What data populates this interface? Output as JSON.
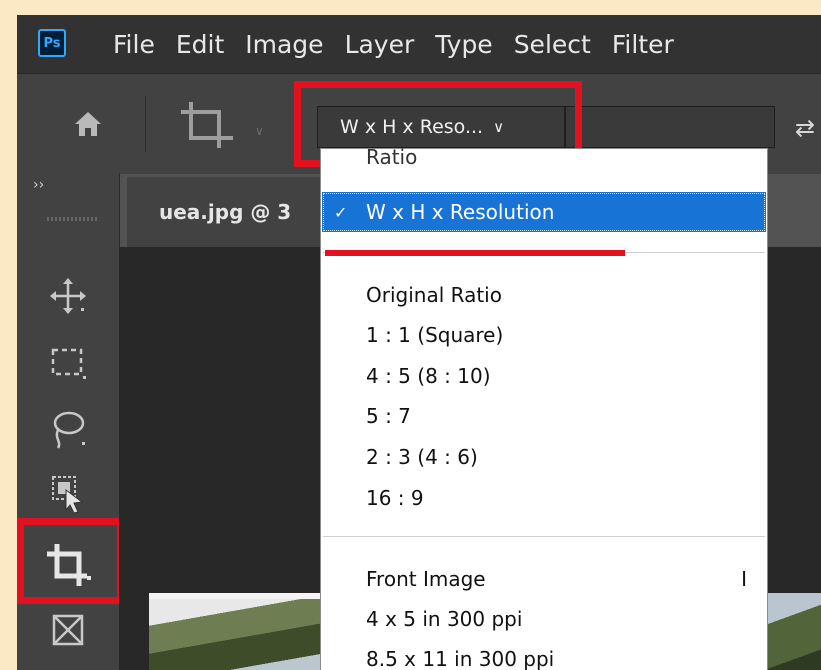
{
  "app": {
    "logo": "Ps"
  },
  "menubar": {
    "items": [
      "File",
      "Edit",
      "Image",
      "Layer",
      "Type",
      "Select",
      "Filter"
    ]
  },
  "options_bar": {
    "preset_value": "W x H x Reso...",
    "preset_chevron": "∨",
    "swap_icon": "⇄"
  },
  "toolbar": {
    "collapse_glyph": "››",
    "tools": [
      "move-tool",
      "marquee-tool",
      "lasso-tool",
      "object-selection-tool",
      "crop-tool",
      "frame-tool"
    ],
    "active_tool": "crop-tool"
  },
  "document": {
    "tab_label": "uea.jpg @ 3"
  },
  "dropdown": {
    "header": "Ratio",
    "selected": {
      "check": "✓",
      "label": "W x H x Resolution"
    },
    "group1": [
      "Original Ratio",
      "1 : 1 (Square)",
      "4 : 5 (8 : 10)",
      "5 : 7",
      "2 : 3 (4 : 6)",
      "16 : 9"
    ],
    "group2": [
      {
        "label": "Front Image",
        "shortcut": "I"
      },
      {
        "label": "4 x 5 in 300 ppi"
      },
      {
        "label": "8.5 x 11 in 300 ppi"
      }
    ]
  },
  "colors": {
    "highlight_red": "#e2111f",
    "selection_blue": "#1773d6",
    "page_background": "#fbe9c6"
  }
}
